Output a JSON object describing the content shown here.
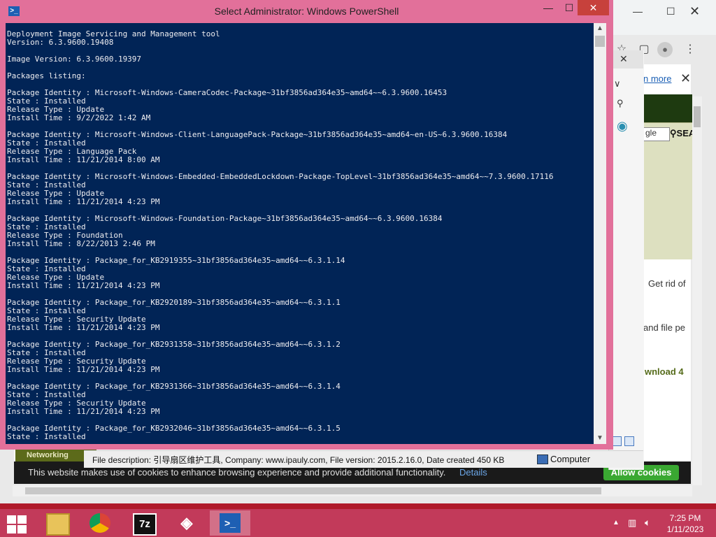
{
  "powershell": {
    "title": "Select Administrator: Windows PowerShell",
    "console_lines": [
      "Deployment Image Servicing and Management tool",
      "Version: 6.3.9600.19408",
      "",
      "Image Version: 6.3.9600.19397",
      "",
      "Packages listing:",
      "",
      "Package Identity : Microsoft-Windows-CameraCodec-Package~31bf3856ad364e35~amd64~~6.3.9600.16453",
      "State : Installed",
      "Release Type : Update",
      "Install Time : 9/2/2022 1:42 AM",
      "",
      "Package Identity : Microsoft-Windows-Client-LanguagePack-Package~31bf3856ad364e35~amd64~en-US~6.3.9600.16384",
      "State : Installed",
      "Release Type : Language Pack",
      "Install Time : 11/21/2014 8:00 AM",
      "",
      "Package Identity : Microsoft-Windows-Embedded-EmbeddedLockdown-Package-TopLevel~31bf3856ad364e35~amd64~~7.3.9600.17116",
      "State : Installed",
      "Release Type : Update",
      "Install Time : 11/21/2014 4:23 PM",
      "",
      "Package Identity : Microsoft-Windows-Foundation-Package~31bf3856ad364e35~amd64~~6.3.9600.16384",
      "State : Installed",
      "Release Type : Foundation",
      "Install Time : 8/22/2013 2:46 PM",
      "",
      "Package Identity : Package_for_KB2919355~31bf3856ad364e35~amd64~~6.3.1.14",
      "State : Installed",
      "Release Type : Update",
      "Install Time : 11/21/2014 4:23 PM",
      "",
      "Package Identity : Package_for_KB2920189~31bf3856ad364e35~amd64~~6.3.1.1",
      "State : Installed",
      "Release Type : Security Update",
      "Install Time : 11/21/2014 4:23 PM",
      "",
      "Package Identity : Package_for_KB2931358~31bf3856ad364e35~amd64~~6.3.1.2",
      "State : Installed",
      "Release Type : Security Update",
      "Install Time : 11/21/2014 4:23 PM",
      "",
      "Package Identity : Package_for_KB2931366~31bf3856ad364e35~amd64~~6.3.1.4",
      "State : Installed",
      "Release Type : Security Update",
      "Install Time : 11/21/2014 4:23 PM",
      "",
      "Package Identity : Package_for_KB2932046~31bf3856ad364e35~amd64~~6.3.1.5",
      "State : Installed"
    ],
    "controls": {
      "minimize": "—",
      "maximize": "☐",
      "close": "✕"
    },
    "colors": {
      "console_bg": "#012456",
      "console_fg": "#eeedf0",
      "frame": "#e2709a"
    }
  },
  "browser": {
    "learn_more": "n more",
    "google_box": "gle",
    "search_label": "SEA",
    "page_fragments": [
      "Get rid of",
      "and file pe",
      "wnload 4"
    ],
    "cookie_text": "This website makes use of cookies to enhance browsing experience and provide additional functionality.",
    "cookie_details": "Details",
    "allow_cookies": "Allow cookies",
    "logo_text": "Networking"
  },
  "explorer_status": {
    "description": "File description: 引导扇区维护工具, Company: www.ipauly.com, File version: 2015.2.16.0, Date created 450 KB",
    "location": "Computer"
  },
  "taskbar": {
    "items": [
      {
        "name": "file-explorer",
        "icon": "folder-icon"
      },
      {
        "name": "chrome",
        "icon": "chrome-icon"
      },
      {
        "name": "7zip",
        "icon": "7z-icon",
        "label": "7z"
      },
      {
        "name": "tool",
        "icon": "diamond-tool-icon"
      },
      {
        "name": "powershell",
        "icon": "powershell-icon",
        "active": true
      }
    ],
    "time": "7:25 PM",
    "date": "1/11/2023"
  }
}
